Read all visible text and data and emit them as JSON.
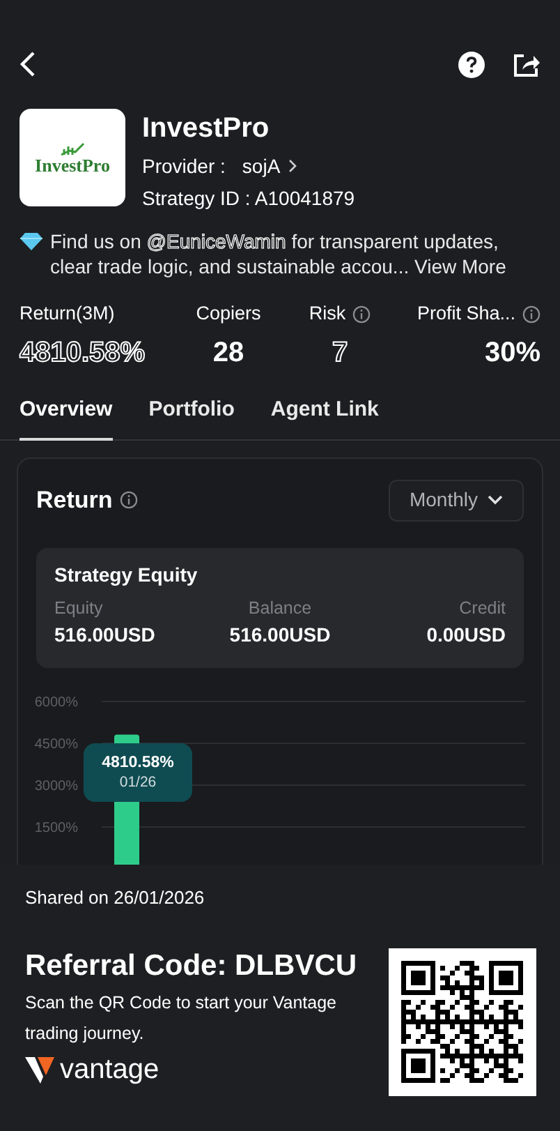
{
  "strategy": {
    "logo_text": "InvestPro",
    "name": "InvestPro",
    "provider_label": "Provider :",
    "provider": "sojA",
    "strategy_id": "Strategy ID : A10041879"
  },
  "description": {
    "before": "Find us on ",
    "handle": "@EuniceWamin",
    "after": " for transparent updates, clear trade logic, and sustainable accou...",
    "link": "View More"
  },
  "stats": [
    {
      "label": "Return(3M)",
      "value": "4810.58%",
      "info": false,
      "kind": "outline"
    },
    {
      "label": "Copiers",
      "value": "28",
      "info": false,
      "kind": "solid"
    },
    {
      "label": "Risk",
      "value": "7",
      "info": true,
      "kind": "outline"
    },
    {
      "label": "Profit Sha...",
      "value": "30%",
      "info": true,
      "kind": "solid"
    }
  ],
  "tabs": [
    {
      "label": "Overview",
      "selected": true
    },
    {
      "label": "Portfolio",
      "selected": false
    },
    {
      "label": "Agent Link",
      "selected": false
    }
  ],
  "return_card": {
    "title": "Return",
    "period": "Monthly",
    "equity": {
      "title": "Strategy Equity",
      "items": [
        {
          "label": "Equity",
          "value": "516.00USD"
        },
        {
          "label": "Balance",
          "value": "516.00USD"
        },
        {
          "label": "Credit",
          "value": "0.00USD"
        }
      ]
    },
    "tooltip": {
      "value": "4810.58%",
      "date": "01/26"
    },
    "chart_data": {
      "type": "bar",
      "grid": true,
      "series": [
        {
          "color": "#2ecc8a",
          "values": [
            4810.58
          ]
        }
      ],
      "ylim": [
        0,
        6000
      ],
      "yticks": [
        {
          "value": 1500,
          "label": "1500%"
        },
        {
          "value": 3000,
          "label": "3000%"
        },
        {
          "value": 4500,
          "label": "4500%"
        },
        {
          "value": 6000,
          "label": "6000%"
        }
      ]
    }
  },
  "footer": {
    "shared": "Shared on 26/01/2026",
    "referral": "Referral Code: DLBVCU",
    "scan_text": "Scan the QR Code to start your Vantage trading journey.",
    "brand": "vantage"
  }
}
